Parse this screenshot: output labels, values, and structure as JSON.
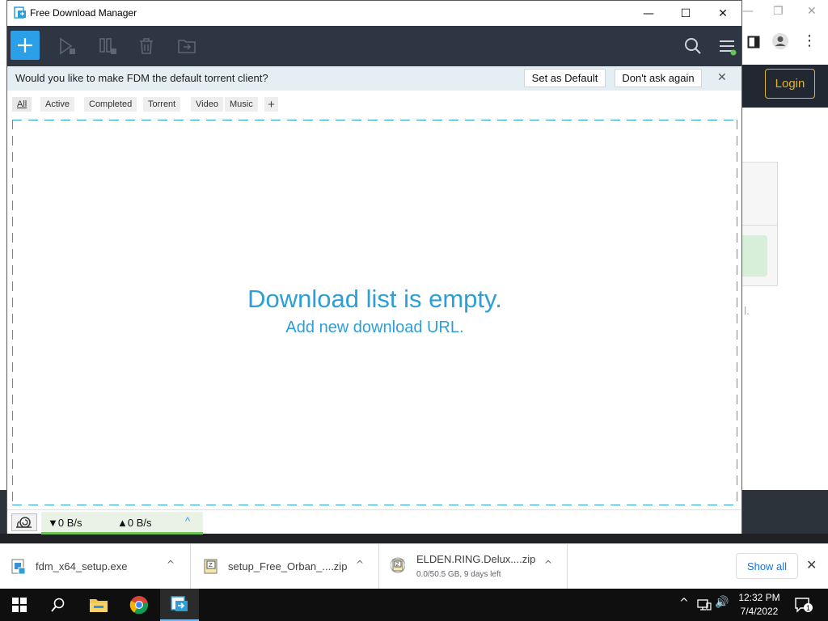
{
  "browser": {
    "login_label": "Login",
    "minimize_glyph": "—",
    "restore_glyph": "❐",
    "close_glyph": "✕",
    "menu_glyph": "⋮",
    "partial_text": "l."
  },
  "fdm": {
    "title": "Free Download Manager",
    "window_controls": {
      "minimize": "—",
      "maximize": "☐",
      "close": "✕"
    },
    "toolbar": {
      "add_glyph": "+",
      "icons": [
        "play-icon",
        "pause-icon",
        "delete-icon",
        "move-folder-icon",
        "search-icon",
        "menu-icon"
      ]
    },
    "notification": {
      "text": "Would you like to make FDM the default torrent client?",
      "set_default_label": "Set as Default",
      "dont_ask_label": "Don't ask again",
      "close_glyph": "✕"
    },
    "tabs": [
      "All",
      "Active",
      "Completed",
      "Torrent",
      "Video",
      "Music"
    ],
    "active_tab": "All",
    "tab_add_glyph": "+",
    "empty": {
      "title": "Download list is empty.",
      "subtitle": "Add new download URL."
    },
    "status": {
      "down_speed": "▼0 B/s",
      "up_speed": "▲0 B/s",
      "chevron": "^"
    }
  },
  "download_shelf": {
    "items": [
      {
        "name": "fdm_x64_setup.exe",
        "status": ""
      },
      {
        "name": "setup_Free_Orban_....zip",
        "status": ""
      },
      {
        "name": "ELDEN.RING.Delux....zip",
        "status": "0.0/50.5 GB, 9 days left"
      }
    ],
    "caret": "^",
    "show_all_label": "Show all",
    "close_glyph": "✕"
  },
  "taskbar": {
    "apps": [
      "windows-start",
      "search",
      "file-explorer",
      "chrome",
      "free-download-manager"
    ],
    "active_app": "free-download-manager",
    "time": "12:32 PM",
    "date": "7/4/2022",
    "tray_chevron": "^",
    "volume_glyph": "🔊",
    "notifications_count": "1"
  },
  "colors": {
    "accent": "#2d9fd8",
    "toolbar_bg": "#2f3643",
    "add_button": "#2ba0e8",
    "login_gold": "#e3b32b",
    "speed_green": "#6fc05a"
  }
}
